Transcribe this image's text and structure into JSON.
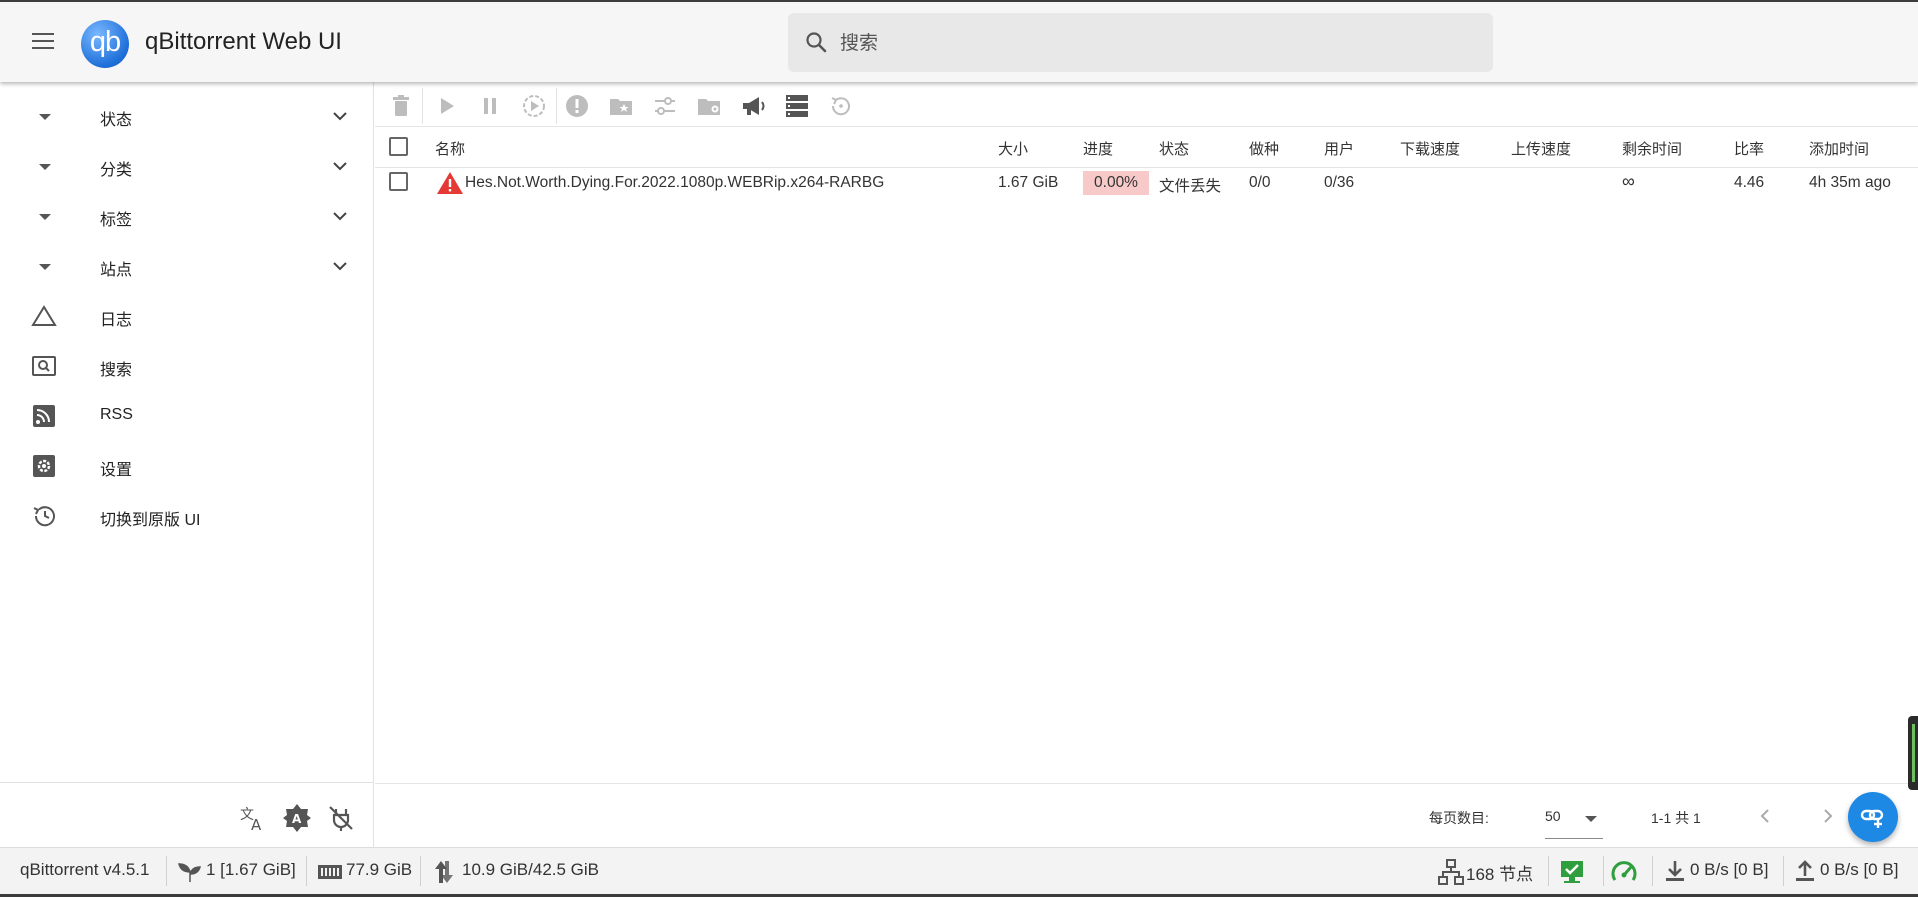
{
  "header": {
    "logo_text": "qb",
    "title": "qBittorrent Web UI",
    "search_placeholder": "搜索"
  },
  "sidebar": {
    "groups": [
      {
        "label": "状态"
      },
      {
        "label": "分类"
      },
      {
        "label": "标签"
      },
      {
        "label": "站点"
      }
    ],
    "items": [
      {
        "label": "日志",
        "icon": "warning-triangle-icon"
      },
      {
        "label": "搜索",
        "icon": "search-box-icon"
      },
      {
        "label": "RSS",
        "icon": "rss-icon"
      },
      {
        "label": "设置",
        "icon": "gear-icon"
      },
      {
        "label": "切换到原版 UI",
        "icon": "history-icon"
      }
    ]
  },
  "toolbar": {
    "buttons": [
      "delete-icon",
      "play-icon",
      "pause-icon",
      "force-start-icon",
      "alert-icon",
      "folder-star-icon",
      "tune-icon",
      "folder-location-icon",
      "announce-icon",
      "server-list-icon",
      "recheck-icon"
    ]
  },
  "table": {
    "columns": [
      "名称",
      "大小",
      "进度",
      "状态",
      "做种",
      "用户",
      "下载速度",
      "上传速度",
      "剩余时间",
      "比率",
      "添加时间"
    ],
    "rows": [
      {
        "name": "Hes.Not.Worth.Dying.For.2022.1080p.WEBRip.x264-RARBG",
        "size": "1.67 GiB",
        "progress": "0.00%",
        "progress_fraction": 0,
        "status": "文件丢失",
        "seeds": "0/0",
        "peers": "0/36",
        "dl_speed": "",
        "ul_speed": "",
        "eta": "∞",
        "ratio": "4.46",
        "added": "4h 35m ago"
      }
    ]
  },
  "pagination": {
    "per_page_label": "每页数目:",
    "per_page_value": "50",
    "range": "1-1 共 1"
  },
  "statusbar": {
    "version": "qBittorrent v4.5.1",
    "torrents": "1 [1.67 GiB]",
    "free_space": "77.9 GiB",
    "session_transfer": "10.9 GiB/42.5 GiB",
    "nodes": "168 节点",
    "download": "0 B/s [0 B]",
    "upload": "0 B/s [0 B]"
  },
  "colors": {
    "accent": "#1e88e5",
    "error": "#e53935",
    "progress_error_bg": "#f8c9c9",
    "connected": "#2e9e3e"
  }
}
